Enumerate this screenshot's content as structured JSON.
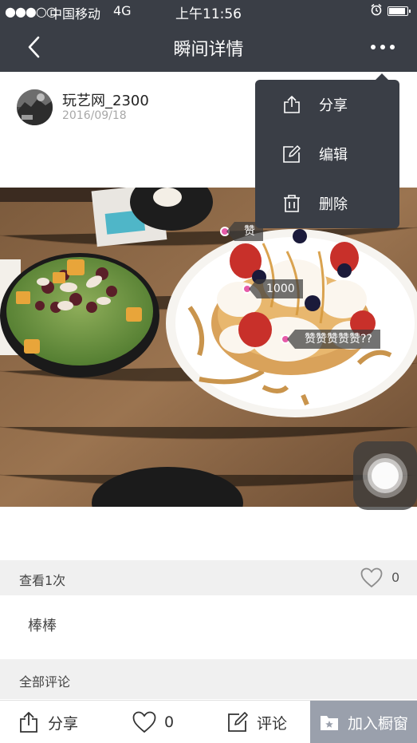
{
  "status_bar": {
    "signal": "●●●○○",
    "carrier": "中国移动",
    "network": "4G",
    "time": "上午11:56"
  },
  "nav": {
    "title": "瞬间详情",
    "back_icon": "chevron-left-icon",
    "more_icon": "more-dots-icon"
  },
  "author": {
    "name": "玩艺网_2300",
    "date": "2016/09/18"
  },
  "photo": {
    "tags": [
      "赞",
      "1000",
      "赞赞赞赞赞??"
    ]
  },
  "stats": {
    "views": "查看1次",
    "likes": "0"
  },
  "caption": "棒棒",
  "comments_header": "全部评论",
  "bottom_bar": {
    "share": "分享",
    "likes": "0",
    "comment": "评论",
    "add": "加入橱窗"
  },
  "menu": {
    "items": [
      {
        "label": "分享",
        "icon": "share-icon"
      },
      {
        "label": "编辑",
        "icon": "edit-icon"
      },
      {
        "label": "删除",
        "icon": "trash-icon"
      }
    ]
  },
  "colors": {
    "nav_bg": "#3a3e46",
    "tag_dot": "#e65ba8",
    "add_button_bg": "#9aa0ac",
    "section_bg": "#f0f0f0"
  }
}
